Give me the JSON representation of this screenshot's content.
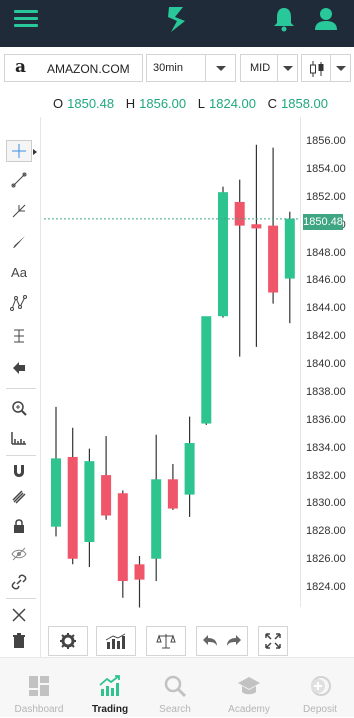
{
  "topbar": {
    "menu_icon": "hamburger-icon",
    "logo_icon": "brand-logo",
    "bell_icon": "bell-icon",
    "user_icon": "user-icon"
  },
  "selectors": {
    "symbol": "AMAZON.COM",
    "symbol_logo": "a",
    "timeframe": "30min",
    "price_mode": "MID",
    "chart_type_icon": "candlestick-icon"
  },
  "ohlc": {
    "o_label": "O",
    "o": "1850.48",
    "h_label": "H",
    "h": "1856.00",
    "l_label": "L",
    "l": "1824.00",
    "c_label": "C",
    "c": "1858.00"
  },
  "price_axis": [
    "1856.00",
    "1854.00",
    "1852.00",
    "1850.00",
    "1848.00",
    "1846.00",
    "1844.00",
    "1842.00",
    "1840.00",
    "1838.00",
    "1836.00",
    "1834.00",
    "1832.00",
    "1830.00",
    "1828.00",
    "1826.00",
    "1824.00"
  ],
  "current_price": "1850.48",
  "colors": {
    "up": "#2ec48f",
    "down": "#f0566a",
    "accent": "#28c89a",
    "header_bg": "#1f2b38"
  },
  "drawing_tools": [
    "crosshair-icon",
    "trend-line-icon",
    "pitchfork-icon",
    "brush-icon",
    "text-icon",
    "pattern-icon",
    "measure-icon",
    "arrow-icon",
    "zoom-in-icon",
    "ruler-icon",
    "magnet-icon",
    "lock-drawing-icon",
    "lock-icon",
    "eye-icon",
    "link-icon",
    "tools-icon",
    "trash-icon"
  ],
  "bottom_tools": [
    "settings-icon",
    "indicators-icon",
    "compare-icon",
    "undo-icon",
    "redo-icon",
    "fullscreen-icon"
  ],
  "nav": [
    {
      "label": "Dashboard",
      "icon": "dashboard-icon",
      "active": false
    },
    {
      "label": "Trading",
      "icon": "trading-icon",
      "active": true
    },
    {
      "label": "Search",
      "icon": "search-icon",
      "active": false
    },
    {
      "label": "Academy",
      "icon": "academy-icon",
      "active": false
    },
    {
      "label": "Deposit",
      "icon": "deposit-icon",
      "active": false
    }
  ],
  "chart_data": {
    "type": "candlestick",
    "symbol": "AMAZON.COM",
    "interval": "30min",
    "ylim": [
      1822.5,
      1857.0
    ],
    "candles": [
      {
        "open": 1828.4,
        "high": 1837.0,
        "low": 1827.7,
        "close": 1833.3
      },
      {
        "open": 1833.4,
        "high": 1835.5,
        "low": 1825.7,
        "close": 1826.1
      },
      {
        "open": 1827.3,
        "high": 1834.0,
        "low": 1825.5,
        "close": 1833.1
      },
      {
        "open": 1832.1,
        "high": 1834.9,
        "low": 1828.9,
        "close": 1829.2
      },
      {
        "open": 1830.8,
        "high": 1831.0,
        "low": 1823.3,
        "close": 1824.5
      },
      {
        "open": 1825.7,
        "high": 1826.3,
        "low": 1822.6,
        "close": 1824.6
      },
      {
        "open": 1826.1,
        "high": 1835.0,
        "low": 1824.5,
        "close": 1831.8
      },
      {
        "open": 1831.8,
        "high": 1832.9,
        "low": 1829.6,
        "close": 1829.7
      },
      {
        "open": 1830.7,
        "high": 1836.3,
        "low": 1829.1,
        "close": 1834.4
      },
      {
        "open": 1835.8,
        "high": 1840.5,
        "low": 1835.7,
        "close": 1843.5
      },
      {
        "open": 1843.5,
        "high": 1852.8,
        "low": 1843.4,
        "close": 1852.4
      },
      {
        "open": 1851.7,
        "high": 1853.3,
        "low": 1840.6,
        "close": 1850.0
      },
      {
        "open": 1850.1,
        "high": 1855.8,
        "low": 1841.3,
        "close": 1849.8
      },
      {
        "open": 1850.0,
        "high": 1855.6,
        "low": 1844.4,
        "close": 1845.2
      },
      {
        "open": 1846.2,
        "high": 1851.0,
        "low": 1843.0,
        "close": 1850.5
      }
    ],
    "last_price": 1850.48,
    "grid": false
  }
}
